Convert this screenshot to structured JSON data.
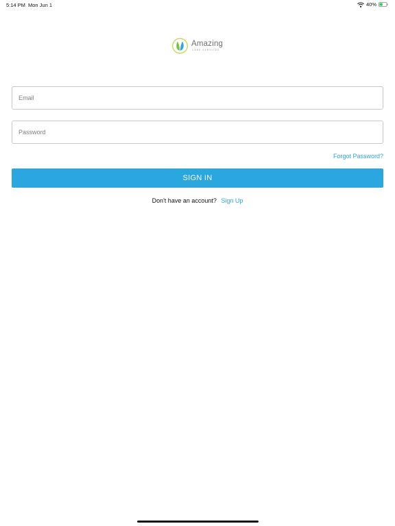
{
  "status_bar": {
    "time": "5:14 PM",
    "date": "Mon Jun 1",
    "battery": "40%",
    "battery_level": 0.4,
    "icons": [
      "wifi-icon",
      "battery-icon"
    ]
  },
  "logo": {
    "name": "Amazing",
    "subtitle": "CARE SERVICES",
    "colors": {
      "leaf_green": "#7cc242",
      "leaf_blue": "#2ba7e0",
      "ring": "#c9d64a"
    }
  },
  "form": {
    "email": {
      "placeholder": "Email",
      "value": ""
    },
    "password": {
      "placeholder": "Password",
      "value": ""
    },
    "forgot_label": "Forgot Password?",
    "signin_label": "SIGN IN"
  },
  "signup": {
    "prompt": "Don't have an account?",
    "link_label": "Sign Up"
  },
  "colors": {
    "accent": "#2ba7e0",
    "border": "#c7c7c7"
  }
}
